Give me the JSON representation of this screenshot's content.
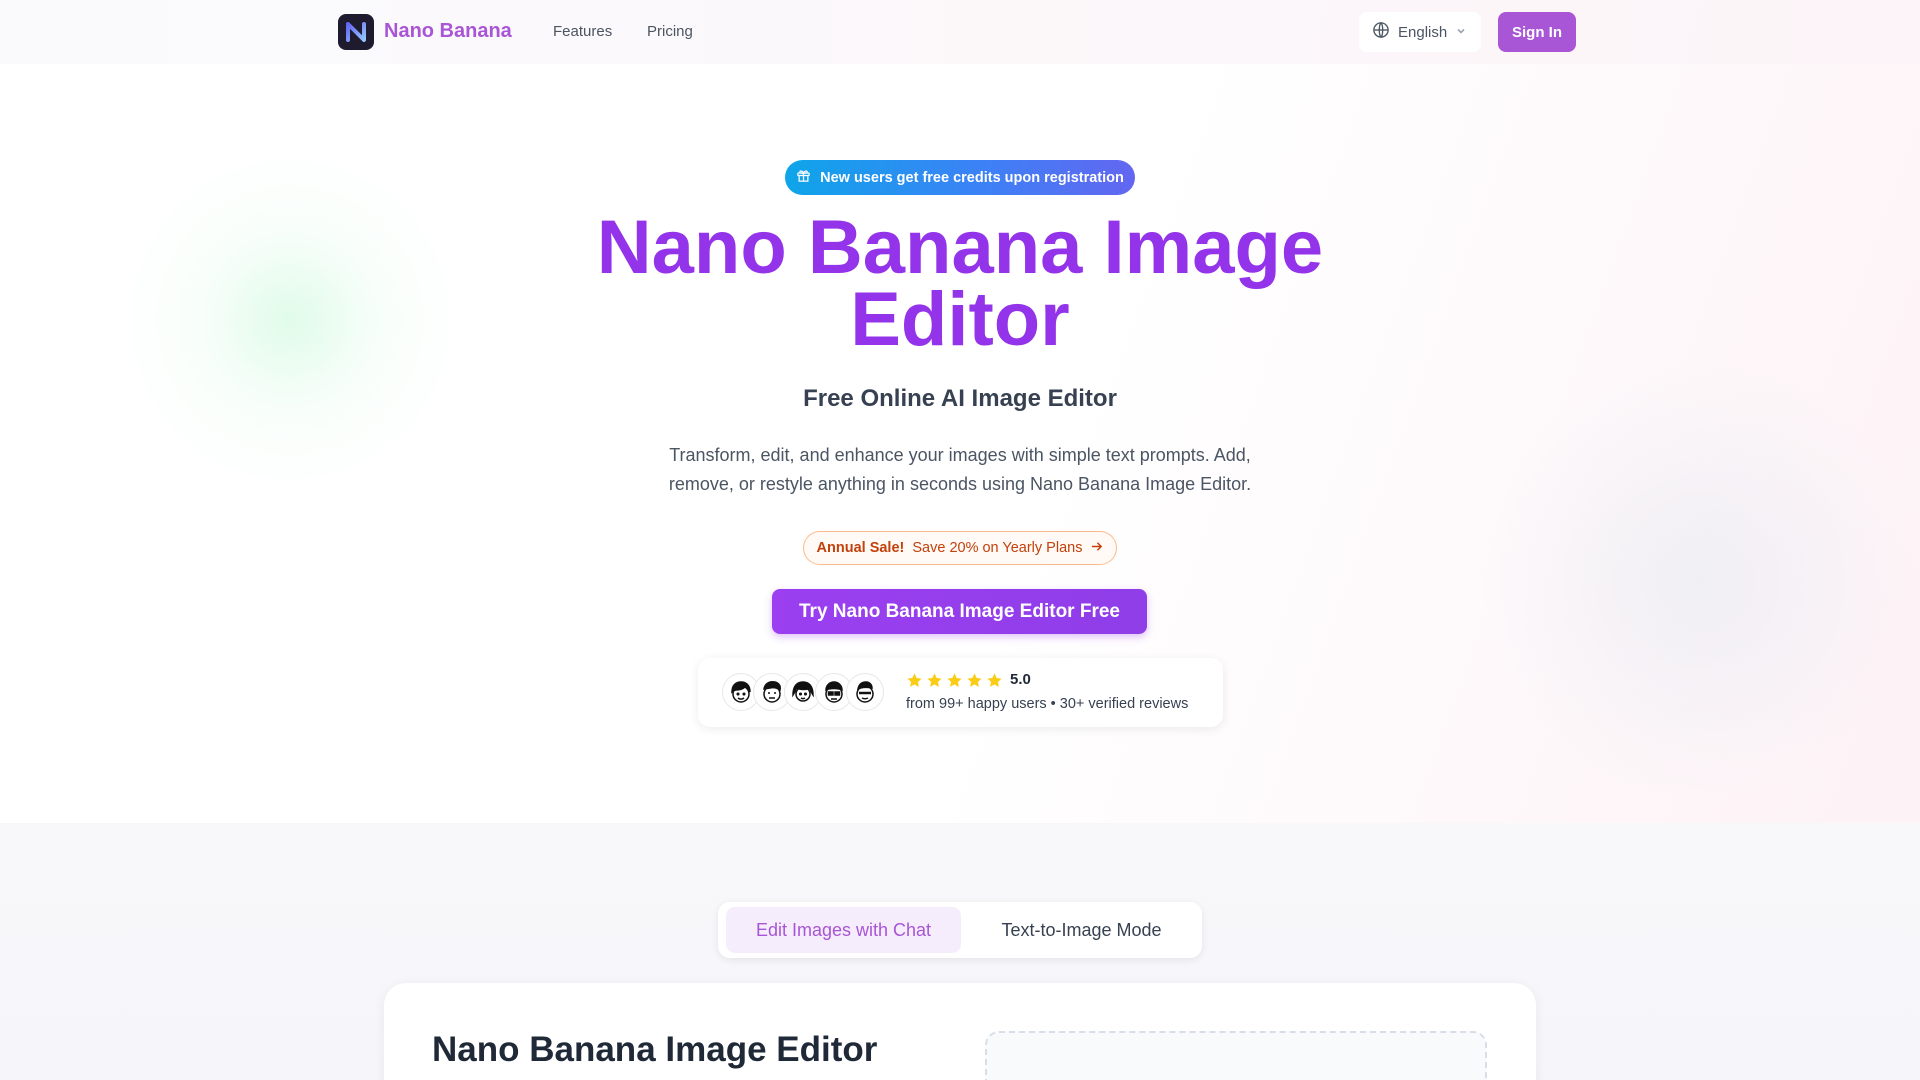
{
  "header": {
    "brand": "Nano Banana",
    "nav": [
      {
        "label": "Features"
      },
      {
        "label": "Pricing"
      }
    ],
    "language": "English",
    "sign_in": "Sign In"
  },
  "hero": {
    "promo": "New users get free credits upon registration",
    "title_line1": "Nano Banana Image",
    "title_line2": "Editor",
    "subtitle": "Free Online AI Image Editor",
    "desc_line1": "Transform, edit, and enhance your images with simple text prompts. Add,",
    "desc_line2": "remove, or restyle anything in seconds using Nano Banana Image Editor.",
    "sale_bold": "Annual Sale!",
    "sale_text": "Save 20% on Yearly Plans",
    "cta": "Try Nano Banana Image Editor Free",
    "rating": {
      "score": "5.0",
      "stars": 5,
      "text": "from 99+ happy users • 30+ verified reviews"
    }
  },
  "tabs": [
    {
      "label": "Edit Images with Chat",
      "active": true
    },
    {
      "label": "Text-to-Image Mode",
      "active": false
    }
  ],
  "editor": {
    "title": "Nano Banana Image Editor"
  },
  "colors": {
    "brand": "#a855d6",
    "title": "#9333ea",
    "cta": "#9b3ff0",
    "star": "#facc15",
    "sale": "#c2410c"
  }
}
